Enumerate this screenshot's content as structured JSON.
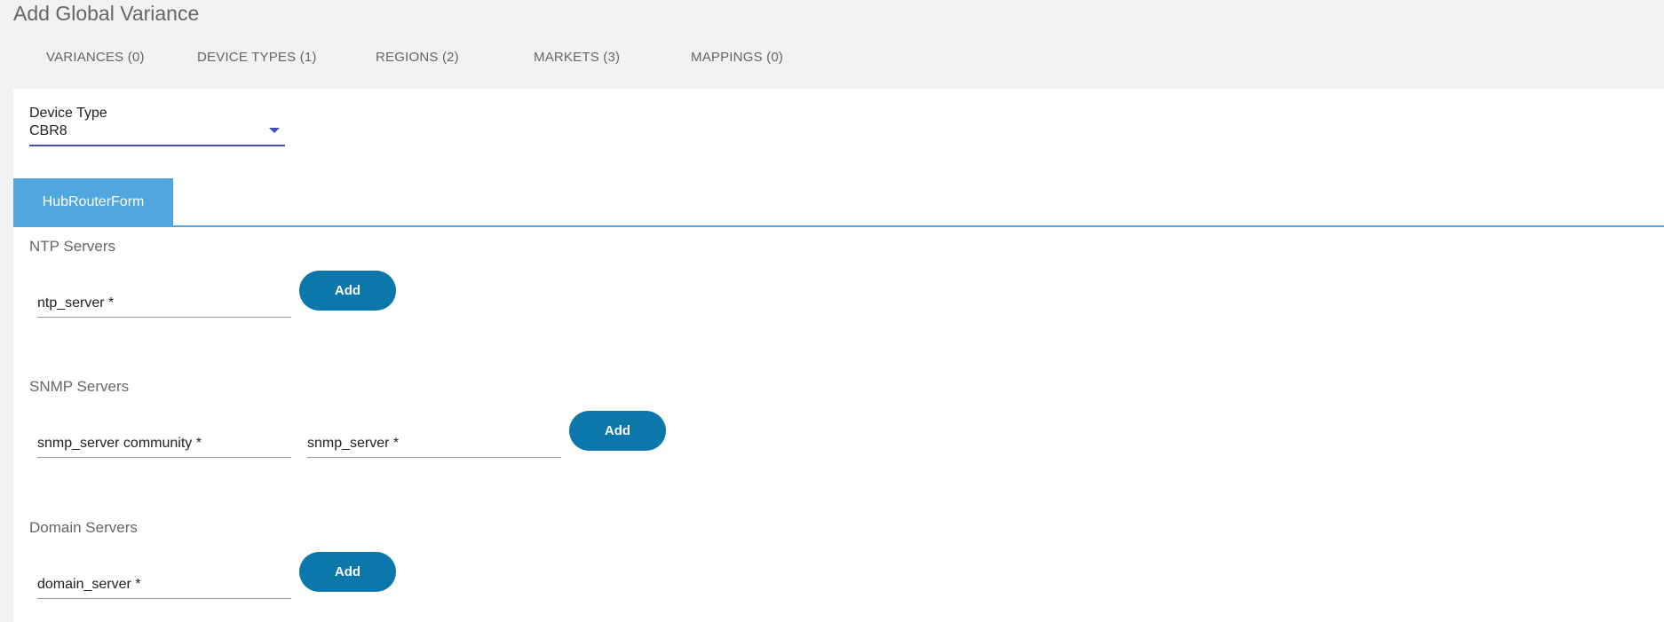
{
  "page": {
    "title": "Add Global Variance"
  },
  "tabs": [
    {
      "label": "VARIANCES (0)"
    },
    {
      "label": "DEVICE TYPES (1)"
    },
    {
      "label": "REGIONS (2)"
    },
    {
      "label": "MARKETS (3)"
    },
    {
      "label": "MAPPINGS (0)"
    }
  ],
  "device_type": {
    "label": "Device Type",
    "value": "CBR8",
    "icon": "dropdown-caret-icon",
    "accent": "#3f51b5"
  },
  "form_tab": {
    "label": "HubRouterForm",
    "color": "#50a6de"
  },
  "sections": {
    "ntp": {
      "title": "NTP Servers",
      "fields": [
        "ntp_server *"
      ],
      "add_label": "Add"
    },
    "snmp": {
      "title": "SNMP Servers",
      "fields": [
        "snmp_server community *",
        "snmp_server *"
      ],
      "add_label": "Add"
    },
    "domain": {
      "title": "Domain Servers",
      "fields": [
        "domain_server *"
      ],
      "add_label": "Add"
    }
  },
  "colors": {
    "button": "#0b77ab",
    "background": "#f2f2f2"
  }
}
